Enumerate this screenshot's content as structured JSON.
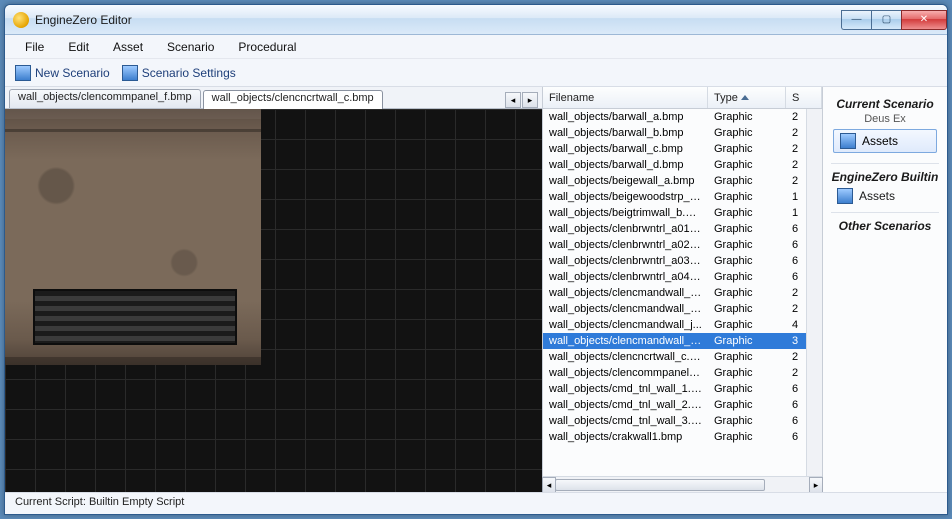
{
  "window": {
    "title": "EngineZero Editor"
  },
  "menus": {
    "file": "File",
    "edit": "Edit",
    "asset": "Asset",
    "scenario": "Scenario",
    "procedural": "Procedural"
  },
  "toolbar": {
    "new_scenario": "New Scenario",
    "scenario_settings": "Scenario Settings"
  },
  "tabs": {
    "items": [
      {
        "label": "wall_objects/clencommpanel_f.bmp"
      },
      {
        "label": "wall_objects/clencncrtwall_c.bmp"
      }
    ],
    "active": 1
  },
  "filetable": {
    "columns": {
      "filename": "Filename",
      "type": "Type",
      "sort_s": "S"
    },
    "selected": 14,
    "rows": [
      {
        "filename": "wall_objects/barwall_a.bmp",
        "type": "Graphic",
        "s": "2"
      },
      {
        "filename": "wall_objects/barwall_b.bmp",
        "type": "Graphic",
        "s": "2"
      },
      {
        "filename": "wall_objects/barwall_c.bmp",
        "type": "Graphic",
        "s": "2"
      },
      {
        "filename": "wall_objects/barwall_d.bmp",
        "type": "Graphic",
        "s": "2"
      },
      {
        "filename": "wall_objects/beigewall_a.bmp",
        "type": "Graphic",
        "s": "2"
      },
      {
        "filename": "wall_objects/beigewoodstrp_a...",
        "type": "Graphic",
        "s": "1"
      },
      {
        "filename": "wall_objects/beigtrimwall_b.bmp",
        "type": "Graphic",
        "s": "1"
      },
      {
        "filename": "wall_objects/clenbrwntrl_a01.b...",
        "type": "Graphic",
        "s": "6"
      },
      {
        "filename": "wall_objects/clenbrwntrl_a02.b...",
        "type": "Graphic",
        "s": "6"
      },
      {
        "filename": "wall_objects/clenbrwntrl_a03.b...",
        "type": "Graphic",
        "s": "6"
      },
      {
        "filename": "wall_objects/clenbrwntrl_a04.b...",
        "type": "Graphic",
        "s": "6"
      },
      {
        "filename": "wall_objects/clencmandwall_c...",
        "type": "Graphic",
        "s": "2"
      },
      {
        "filename": "wall_objects/clencmandwall_e...",
        "type": "Graphic",
        "s": "2"
      },
      {
        "filename": "wall_objects/clencmandwall_j...",
        "type": "Graphic",
        "s": "4"
      },
      {
        "filename": "wall_objects/clencmandwall_k...",
        "type": "Graphic",
        "s": "3"
      },
      {
        "filename": "wall_objects/clencncrtwall_c.b...",
        "type": "Graphic",
        "s": "2"
      },
      {
        "filename": "wall_objects/clencommpanel_f...",
        "type": "Graphic",
        "s": "2"
      },
      {
        "filename": "wall_objects/cmd_tnl_wall_1.b...",
        "type": "Graphic",
        "s": "6"
      },
      {
        "filename": "wall_objects/cmd_tnl_wall_2.b...",
        "type": "Graphic",
        "s": "6"
      },
      {
        "filename": "wall_objects/cmd_tnl_wall_3.b...",
        "type": "Graphic",
        "s": "6"
      },
      {
        "filename": "wall_objects/crakwall1.bmp",
        "type": "Graphic",
        "s": "6"
      }
    ]
  },
  "sidepanel": {
    "current_heading": "Current Scenario",
    "current_name": "Deus Ex",
    "assets_label": "Assets",
    "builtin_heading": "EngineZero Builtin",
    "other_heading": "Other Scenarios"
  },
  "statusbar": {
    "text": "Current Script: Builtin Empty Script"
  }
}
